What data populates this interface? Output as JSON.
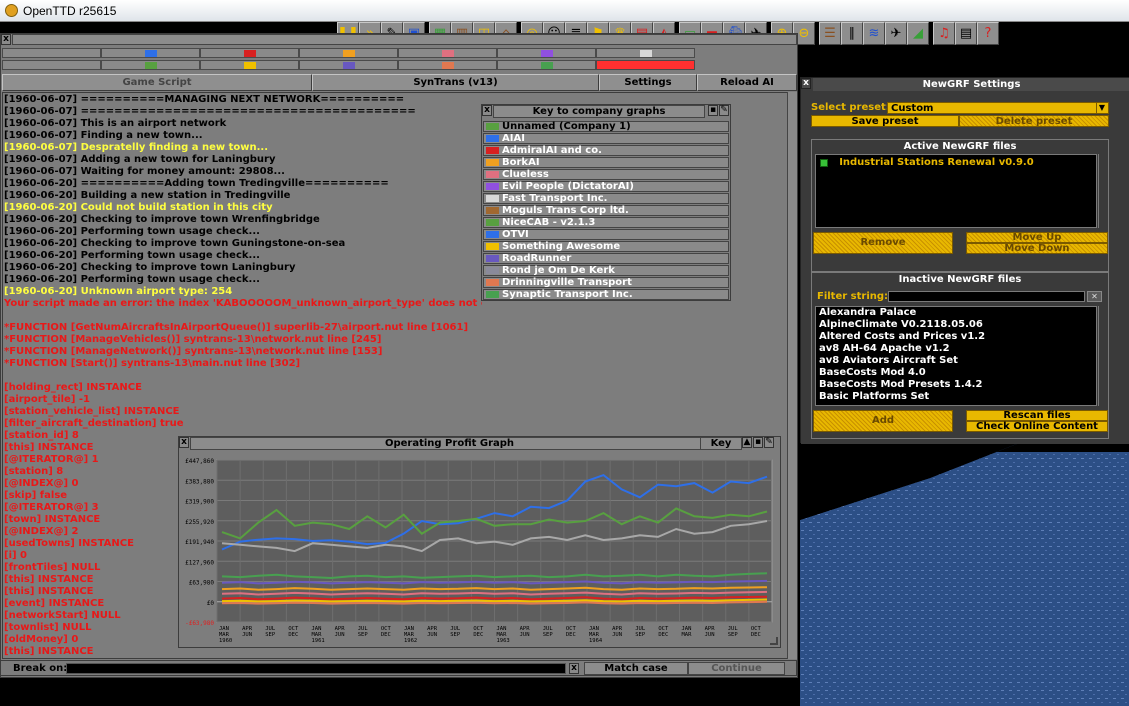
{
  "window": {
    "title": "OpenTTD r25615"
  },
  "companies": {
    "row1": [
      "#2e6fe8",
      "#d82020",
      "#f0a020",
      "#e07080",
      "#9050e0",
      "#d8d8d8"
    ],
    "row2": [
      "#58a040",
      "#f0c000",
      "#6858c0",
      "#e07850",
      "#48a050",
      "#c8a858"
    ],
    "selected_color": "#ff3030"
  },
  "ai_debug": {
    "tabs": {
      "game_script": "Game Script",
      "syntrans": "SynTrans (v13)",
      "settings": "Settings",
      "reload": "Reload AI"
    },
    "log": [
      {
        "t": "[1960-06-07] ==========MANAGING NEXT NETWORK==========",
        "c": "w"
      },
      {
        "t": "[1960-06-07] ========================================",
        "c": "w"
      },
      {
        "t": "[1960-06-07] This is an airport network",
        "c": "w"
      },
      {
        "t": "[1960-06-07] Finding a new town...",
        "c": "w"
      },
      {
        "t": "[1960-06-07] Despratelly finding a new town...",
        "c": "y"
      },
      {
        "t": "[1960-06-07] Adding a new town for Laningbury",
        "c": "w"
      },
      {
        "t": "[1960-06-07] Waiting for money amount: 29808...",
        "c": "w"
      },
      {
        "t": "[1960-06-20] ==========Adding town Tredingville==========",
        "c": "w"
      },
      {
        "t": "[1960-06-20] Building a new station in Tredingville",
        "c": "w"
      },
      {
        "t": "[1960-06-20] Could not build station in this city",
        "c": "y"
      },
      {
        "t": "[1960-06-20] Checking to improve town Wrenfingbridge",
        "c": "w"
      },
      {
        "t": "[1960-06-20] Performing town usage check...",
        "c": "w"
      },
      {
        "t": "[1960-06-20] Checking to improve town Guningstone-on-sea",
        "c": "w"
      },
      {
        "t": "[1960-06-20] Performing town usage check...",
        "c": "w"
      },
      {
        "t": "[1960-06-20] Checking to improve town Laningbury",
        "c": "w"
      },
      {
        "t": "[1960-06-20] Performing town usage check...",
        "c": "w"
      },
      {
        "t": "[1960-06-20] Unknown airport type: 254",
        "c": "y"
      },
      {
        "t": "Your script made an error: the index 'KABOOOOOM_unknown_airport_type' does not exist",
        "c": "r"
      },
      {
        "t": "",
        "c": "w"
      },
      {
        "t": "*FUNCTION [GetNumAircraftsInAirportQueue()] superlib-27\\airport.nut line [1061]",
        "c": "r"
      },
      {
        "t": "*FUNCTION [ManageVehicles()] syntrans-13\\network.nut line [245]",
        "c": "r"
      },
      {
        "t": "*FUNCTION [ManageNetwork()] syntrans-13\\network.nut line [153]",
        "c": "r"
      },
      {
        "t": "*FUNCTION [Start()] syntrans-13\\main.nut line [302]",
        "c": "r"
      },
      {
        "t": "",
        "c": "w"
      },
      {
        "t": "[holding_rect] INSTANCE",
        "c": "r"
      },
      {
        "t": "[airport_tile] -1",
        "c": "r"
      },
      {
        "t": "[station_vehicle_list] INSTANCE",
        "c": "r"
      },
      {
        "t": "[filter_aircraft_destination] true",
        "c": "r"
      },
      {
        "t": "[station_id] 8",
        "c": "r"
      },
      {
        "t": "[this] INSTANCE",
        "c": "r"
      },
      {
        "t": "[@ITERATOR@] 1",
        "c": "r"
      },
      {
        "t": "[station] 8",
        "c": "r"
      },
      {
        "t": "[@INDEX@] 0",
        "c": "r"
      },
      {
        "t": "[skip] false",
        "c": "r"
      },
      {
        "t": "[@ITERATOR@] 3",
        "c": "r"
      },
      {
        "t": "[town] INSTANCE",
        "c": "r"
      },
      {
        "t": "[@INDEX@] 2",
        "c": "r"
      },
      {
        "t": "[usedTowns] INSTANCE",
        "c": "r"
      },
      {
        "t": "[i] 0",
        "c": "r"
      },
      {
        "t": "[frontTiles] NULL",
        "c": "r"
      },
      {
        "t": "[this] INSTANCE",
        "c": "r"
      },
      {
        "t": "[this] INSTANCE",
        "c": "r"
      },
      {
        "t": "[event] INSTANCE",
        "c": "r"
      },
      {
        "t": "[networkStart] NULL",
        "c": "r"
      },
      {
        "t": "[townlist] NULL",
        "c": "r"
      },
      {
        "t": "[oldMoney] 0",
        "c": "r"
      },
      {
        "t": "[this] INSTANCE",
        "c": "r"
      }
    ],
    "break_on_label": "Break on:",
    "match_case": "Match case",
    "continue": "Continue"
  },
  "key_window": {
    "title": "Key to company graphs",
    "entries": [
      {
        "name": "Unnamed (Company 1)",
        "color": "#58a040"
      },
      {
        "name": "AIAI",
        "color": "#2e6fe8"
      },
      {
        "name": "AdmiralAI and co.",
        "color": "#d82020"
      },
      {
        "name": "BorkAI",
        "color": "#f0a020"
      },
      {
        "name": "Clueless",
        "color": "#e07080"
      },
      {
        "name": "Evil People (DictatorAI)",
        "color": "#9050e0"
      },
      {
        "name": "Fast Transport Inc.",
        "color": "#d8d8d8"
      },
      {
        "name": "Moguls Trans Corp ltd.",
        "color": "#a06830"
      },
      {
        "name": "NiceCAB - v2.1.3",
        "color": "#58a040"
      },
      {
        "name": "OTVI",
        "color": "#2e6fe8"
      },
      {
        "name": "Something Awesome",
        "color": "#f0c000"
      },
      {
        "name": "RoadRunner",
        "color": "#6858c0"
      },
      {
        "name": "Rond je Om De Kerk",
        "color": "#8a8a9a"
      },
      {
        "name": "Drinningville Transport",
        "color": "#e07850"
      },
      {
        "name": "Synaptic Transport Inc.",
        "color": "#48a050"
      }
    ]
  },
  "graph": {
    "title": "Operating Profit Graph",
    "key_button": "Key"
  },
  "chart_data": {
    "type": "line",
    "title": "Operating Profit Graph",
    "y_ticks": [
      "£447,860",
      "£383,880",
      "£319,900",
      "£255,920",
      "£191,940",
      "£127,960",
      "£63,980",
      "£0",
      "-£63,980"
    ],
    "ylim": [
      -63980,
      447860
    ],
    "x_ticks": [
      [
        "JAN",
        "MAR",
        "1960"
      ],
      [
        "APR",
        "JUN",
        ""
      ],
      [
        "JUL",
        "SEP",
        ""
      ],
      [
        "OCT",
        "DEC",
        ""
      ],
      [
        "JAN",
        "MAR",
        "1961"
      ],
      [
        "APR",
        "JUN",
        ""
      ],
      [
        "JUL",
        "SEP",
        ""
      ],
      [
        "OCT",
        "DEC",
        ""
      ],
      [
        "JAN",
        "MAR",
        "1962"
      ],
      [
        "APR",
        "JUN",
        ""
      ],
      [
        "JUL",
        "SEP",
        ""
      ],
      [
        "OCT",
        "DEC",
        ""
      ],
      [
        "JAN",
        "MAR",
        "1963"
      ],
      [
        "APR",
        "JUN",
        ""
      ],
      [
        "JUL",
        "SEP",
        ""
      ],
      [
        "OCT",
        "DEC",
        ""
      ],
      [
        "JAN",
        "MAR",
        "1964"
      ],
      [
        "APR",
        "JUN",
        ""
      ],
      [
        "JUL",
        "SEP",
        ""
      ],
      [
        "OCT",
        "DEC",
        ""
      ],
      [
        "JAN",
        "MAR",
        ""
      ],
      [
        "APR",
        "JUN",
        ""
      ],
      [
        "JUL",
        "SEP",
        ""
      ],
      [
        "OCT",
        "DEC",
        ""
      ]
    ],
    "series": [
      {
        "color": "#2e6fe8",
        "values": [
          165000,
          190000,
          196000,
          200000,
          198000,
          192000,
          194000,
          190000,
          182000,
          186000,
          215000,
          255000,
          245000,
          248000,
          262000,
          280000,
          270000,
          300000,
          296000,
          320000,
          380000,
          400000,
          355000,
          330000,
          370000,
          365000,
          375000,
          345000,
          380000,
          375000,
          395000
        ]
      },
      {
        "color": "#58a040",
        "values": [
          220000,
          200000,
          250000,
          290000,
          240000,
          250000,
          245000,
          230000,
          270000,
          235000,
          275000,
          215000,
          250000,
          255000,
          262000,
          240000,
          245000,
          245000,
          260000,
          250000,
          255000,
          280000,
          245000,
          270000,
          250000,
          295000,
          270000,
          265000,
          275000,
          270000,
          285000
        ]
      },
      {
        "color": "#a8a8a8",
        "values": [
          185000,
          180000,
          175000,
          170000,
          160000,
          185000,
          180000,
          175000,
          170000,
          180000,
          175000,
          160000,
          195000,
          200000,
          185000,
          190000,
          180000,
          200000,
          205000,
          195000,
          210000,
          195000,
          200000,
          210000,
          205000,
          230000,
          215000,
          220000,
          240000,
          245000,
          255000
        ]
      },
      {
        "color": "#48a050",
        "values": [
          80000,
          78000,
          82000,
          85000,
          80000,
          78000,
          75000,
          80000,
          82000,
          78000,
          80000,
          76000,
          78000,
          80000,
          82000,
          78000,
          80000,
          82000,
          78000,
          80000,
          85000,
          80000,
          82000,
          85000,
          80000,
          85000,
          82000,
          80000,
          85000,
          88000,
          90000
        ]
      },
      {
        "color": "#6858c0",
        "values": [
          60000,
          62000,
          58000,
          60000,
          63000,
          61000,
          58000,
          60000,
          62000,
          60000,
          58000,
          62000,
          60000,
          61000,
          63000,
          60000,
          62000,
          58000,
          60000,
          62000,
          64000,
          60000,
          58000,
          62000,
          60000,
          61000,
          63000,
          62000,
          64000,
          65000,
          66000
        ]
      },
      {
        "color": "#f0a020",
        "values": [
          40000,
          42000,
          38000,
          40000,
          43000,
          41000,
          38000,
          40000,
          42000,
          40000,
          38000,
          42000,
          40000,
          41000,
          43000,
          40000,
          42000,
          38000,
          40000,
          42000,
          44000,
          40000,
          38000,
          42000,
          40000,
          41000,
          43000,
          42000,
          44000,
          45000,
          46000
        ]
      },
      {
        "color": "#e07080",
        "values": [
          25000,
          27000,
          23000,
          25000,
          28000,
          26000,
          23000,
          25000,
          27000,
          25000,
          23000,
          27000,
          25000,
          26000,
          28000,
          25000,
          27000,
          23000,
          25000,
          27000,
          29000,
          25000,
          23000,
          27000,
          25000,
          26000,
          28000,
          27000,
          29000,
          30000,
          31000
        ]
      },
      {
        "color": "#d82020",
        "values": [
          10000,
          12000,
          8000,
          10000,
          13000,
          11000,
          8000,
          10000,
          12000,
          10000,
          8000,
          12000,
          10000,
          11000,
          13000,
          10000,
          12000,
          8000,
          10000,
          12000,
          14000,
          10000,
          8000,
          12000,
          10000,
          11000,
          13000,
          12000,
          14000,
          15000,
          16000
        ]
      },
      {
        "color": "#f0c000",
        "values": [
          2000,
          3000,
          1000,
          2000,
          4000,
          3000,
          1000,
          2000,
          3000,
          2000,
          1000,
          3000,
          2000,
          3000,
          4000,
          2000,
          3000,
          1000,
          2000,
          3000,
          5000,
          2000,
          1000,
          3000,
          2000,
          3000,
          4000,
          3000,
          5000,
          6000,
          7000
        ]
      },
      {
        "color": "#e07850",
        "values": [
          -5000,
          -4000,
          -6000,
          -5000,
          -3000,
          -4000,
          -6000,
          -5000,
          -4000,
          -5000,
          -6000,
          -4000,
          -5000,
          -4000,
          -3000,
          -5000,
          -4000,
          -6000,
          -5000,
          -4000,
          -2000,
          -5000,
          -6000,
          -4000,
          -5000,
          -4000,
          -3000,
          -4000,
          -2000,
          -1000,
          0
        ]
      }
    ]
  },
  "newgrf": {
    "title": "NewGRF Settings",
    "select_preset_label": "Select preset:",
    "preset_value": "Custom",
    "save_preset": "Save preset",
    "delete_preset": "Delete preset",
    "active_title": "Active NewGRF files",
    "active_files": [
      "Industrial Stations Renewal v0.9.0"
    ],
    "remove": "Remove",
    "move_up": "Move Up",
    "move_down": "Move Down",
    "inactive_title": "Inactive NewGRF files",
    "filter_label": "Filter string:",
    "inactive_files": [
      "Alexandra Palace",
      "AlpineClimate V0.2118.05.06",
      "Altered Costs and Prices v1.2",
      "av8 AH-64 Apache v1.2",
      "av8 Aviators Aircraft Set",
      "BaseCosts Mod 4.0",
      "BaseCosts Mod Presets 1.4.2",
      "Basic Platforms Set"
    ],
    "add": "Add",
    "rescan": "Rescan files",
    "check_online": "Check Online Content"
  }
}
